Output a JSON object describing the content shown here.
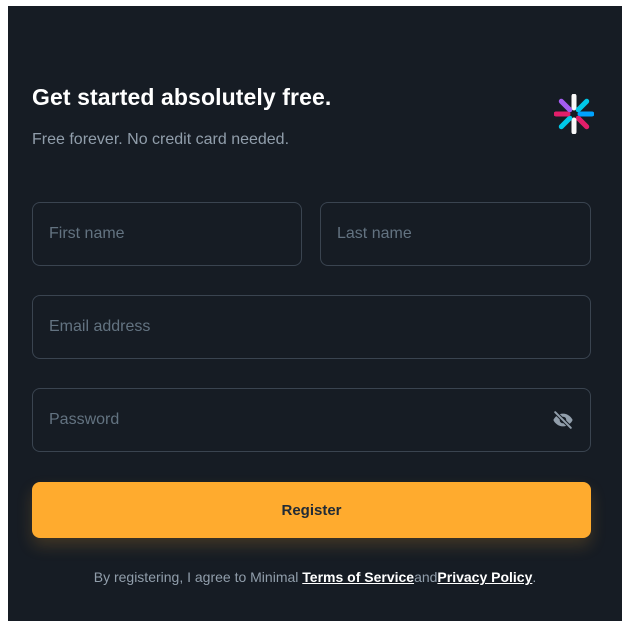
{
  "header": {
    "title": "Get started absolutely free.",
    "subtitle": "Free forever. No credit card needed.",
    "logo_icon": "spinner-burst-logo-icon"
  },
  "form": {
    "first_name_placeholder": "First name",
    "last_name_placeholder": "Last name",
    "email_placeholder": "Email address",
    "password_placeholder": "Password",
    "password_toggle_icon": "eye-off-icon",
    "register_label": "Register"
  },
  "terms": {
    "prefix": "By registering, I agree to Minimal ",
    "terms_link": "Terms of Service",
    "conjunction": "and",
    "privacy_link": "Privacy Policy",
    "suffix": "."
  },
  "colors": {
    "background": "#161C24",
    "accent": "#FFAB2E",
    "text_secondary": "#919EAB",
    "border": "#3a4450"
  }
}
